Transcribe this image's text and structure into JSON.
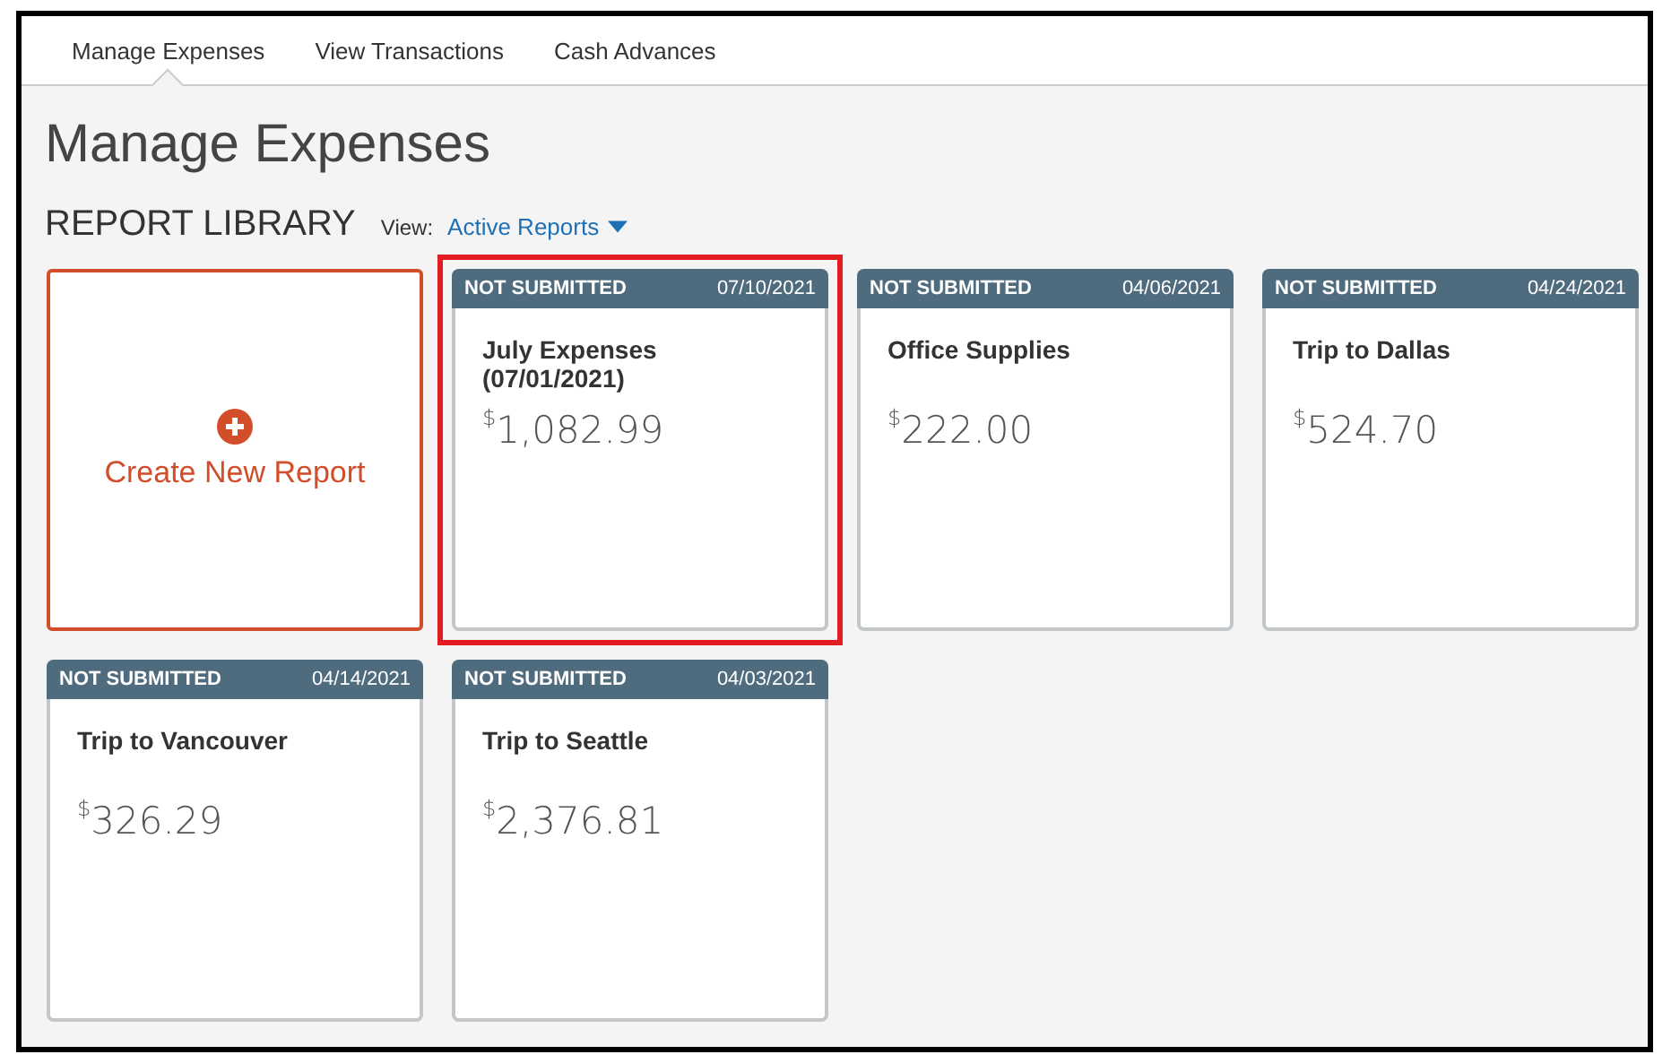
{
  "tabs": [
    {
      "label": "Manage Expenses",
      "selected": true
    },
    {
      "label": "View Transactions",
      "selected": false
    },
    {
      "label": "Cash Advances",
      "selected": false
    }
  ],
  "page_title": "Manage Expenses",
  "library": {
    "heading": "REPORT LIBRARY",
    "view_label": "View:",
    "view_value": "Active Reports"
  },
  "create_card": {
    "label": "Create New Report"
  },
  "reports": [
    {
      "status": "NOT SUBMITTED",
      "date": "07/10/2021",
      "name": "July Expenses (07/01/2021)",
      "currency": "$",
      "amount": "1,082.99",
      "highlighted": true
    },
    {
      "status": "NOT SUBMITTED",
      "date": "04/06/2021",
      "name": "Office Supplies",
      "currency": "$",
      "amount": "222.00",
      "highlighted": false
    },
    {
      "status": "NOT SUBMITTED",
      "date": "04/24/2021",
      "name": "Trip to Dallas",
      "currency": "$",
      "amount": "524.70",
      "highlighted": false
    },
    {
      "status": "NOT SUBMITTED",
      "date": "04/14/2021",
      "name": "Trip to Vancouver",
      "currency": "$",
      "amount": "326.29",
      "highlighted": false
    },
    {
      "status": "NOT SUBMITTED",
      "date": "04/03/2021",
      "name": "Trip to Seattle",
      "currency": "$",
      "amount": "2,376.81",
      "highlighted": false
    }
  ]
}
